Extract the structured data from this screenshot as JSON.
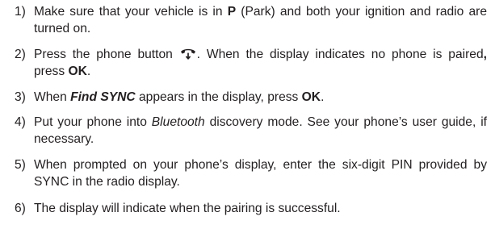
{
  "steps": [
    {
      "number": "1)",
      "parts": [
        {
          "t": "Make sure that your vehicle is in "
        },
        {
          "t": "P",
          "b": true
        },
        {
          "t": " (Park) and both your ignition and radio are turned on."
        }
      ]
    },
    {
      "number": "2)",
      "parts": [
        {
          "t": "Press the phone button "
        },
        {
          "icon": "phone-icon"
        },
        {
          "t": ". When the display indicates no phone is paired"
        },
        {
          "t": ",",
          "b": true
        },
        {
          "t": " press "
        },
        {
          "t": "OK",
          "b": true
        },
        {
          "t": "."
        }
      ]
    },
    {
      "number": "3)",
      "parts": [
        {
          "t": "When "
        },
        {
          "t": "Find SYNC",
          "b": true,
          "i": true
        },
        {
          "t": " appears in the display, press "
        },
        {
          "t": "OK",
          "b": true
        },
        {
          "t": "."
        }
      ]
    },
    {
      "number": "4)",
      "parts": [
        {
          "t": "Put your phone into "
        },
        {
          "t": "Bluetooth",
          "i": true
        },
        {
          "t": " discovery mode. See your phone’s user guide, if necessary."
        }
      ]
    },
    {
      "number": "5)",
      "parts": [
        {
          "t": "When prompted on your phone’s display, enter the six-digit PIN provided by SYNC in the radio display."
        }
      ]
    },
    {
      "number": "6)",
      "parts": [
        {
          "t": "The display will indicate when the pairing is successful."
        }
      ]
    }
  ]
}
